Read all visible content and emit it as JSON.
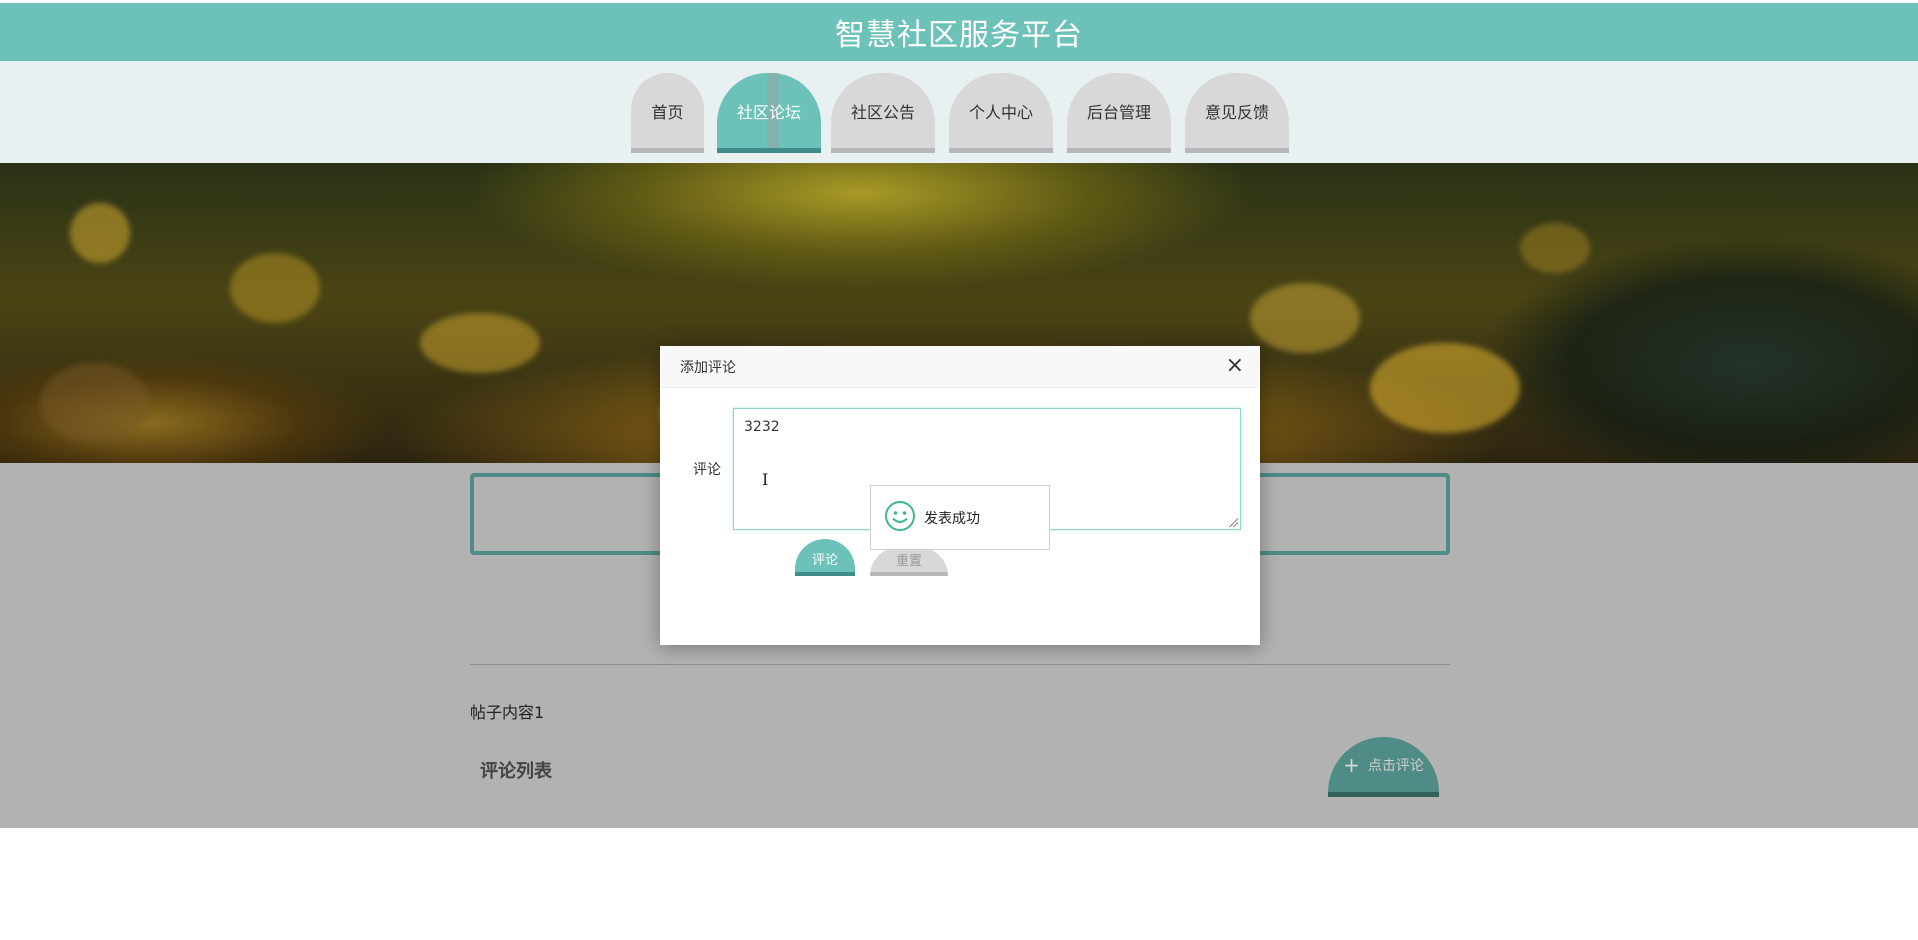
{
  "header": {
    "title": "智慧社区服务平台"
  },
  "nav": [
    {
      "label": "首页",
      "active": false
    },
    {
      "label": "社区论坛",
      "active": true
    },
    {
      "label": "社区公告",
      "active": false
    },
    {
      "label": "个人中心",
      "active": false
    },
    {
      "label": "后台管理",
      "active": false
    },
    {
      "label": "意见反馈",
      "active": false
    }
  ],
  "post": {
    "content": "帖子内容1",
    "comments_title": "评论列表",
    "click_comment_label": "点击评论"
  },
  "dialog": {
    "title": "添加评论",
    "field_label": "评论",
    "field_value": "3232",
    "submit_label": "评论",
    "reset_label": "重置"
  },
  "toast": {
    "message": "发表成功",
    "icon": "smile-icon"
  },
  "colors": {
    "accent": "#6cc2b9",
    "accent_dark": "#4f8c86",
    "overlay_gray": "#b2b2b2"
  }
}
